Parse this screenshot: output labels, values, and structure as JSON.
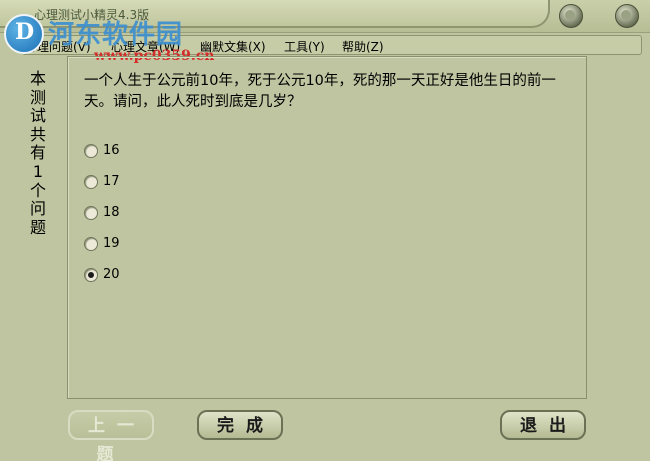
{
  "window": {
    "title": "心理测试小精灵4.3版"
  },
  "watermark": {
    "name": "河东软件园",
    "url": "www.pc0359.cn",
    "logo_glyph": "D"
  },
  "menu": [
    {
      "label": "心理问题(V)"
    },
    {
      "label": "心理文章(W)"
    },
    {
      "label": "幽默文集(X)"
    },
    {
      "label": "工具(Y)"
    },
    {
      "label": "帮助(Z)"
    }
  ],
  "side_label": "本测试共有1个问题",
  "question": "一个人生于公元前10年，死于公元10年，死的那一天正好是他生日的前一天。请问，此人死时到底是几岁？",
  "options": [
    {
      "label": "16",
      "checked": false
    },
    {
      "label": "17",
      "checked": false
    },
    {
      "label": "18",
      "checked": false
    },
    {
      "label": "19",
      "checked": false
    },
    {
      "label": "20",
      "checked": true
    }
  ],
  "buttons": {
    "prev": "上一题",
    "done": "完成",
    "exit": "退出"
  }
}
